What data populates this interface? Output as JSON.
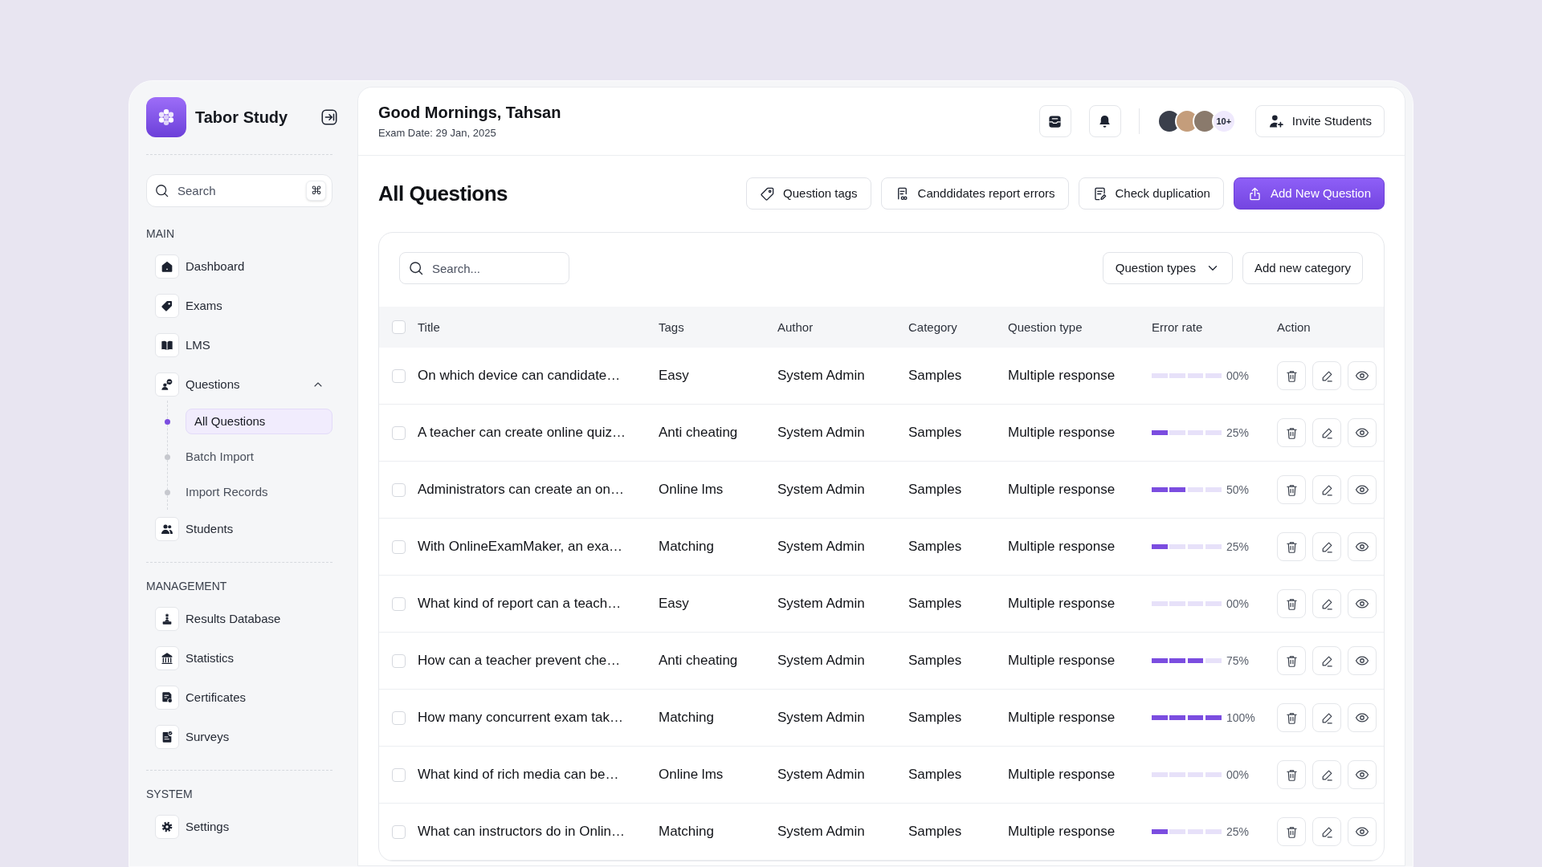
{
  "sidebar": {
    "brand": "Tabor Study",
    "search": {
      "placeholder": "Search",
      "shortcut": "⌘"
    },
    "sections": [
      {
        "heading": "MAIN",
        "items": [
          {
            "label": "Dashboard",
            "selected": false
          },
          {
            "label": "Exams",
            "selected": false
          },
          {
            "label": "LMS",
            "selected": false
          },
          {
            "label": "Questions",
            "selected": false,
            "expanded": true,
            "children": [
              {
                "label": "All Questions",
                "selected": true
              },
              {
                "label": "Batch Import",
                "selected": false
              },
              {
                "label": "Import Records",
                "selected": false
              }
            ]
          },
          {
            "label": "Students",
            "selected": false
          }
        ]
      },
      {
        "heading": "MANAGEMENT",
        "items": [
          {
            "label": "Results Database",
            "selected": false
          },
          {
            "label": "Statistics",
            "selected": false
          },
          {
            "label": "Certificates",
            "selected": false
          },
          {
            "label": "Surveys",
            "selected": false
          }
        ]
      },
      {
        "heading": "SYSTEM",
        "items": [
          {
            "label": "Settings",
            "selected": false
          }
        ]
      }
    ]
  },
  "header": {
    "greeting": "Good Mornings, Tahsan",
    "exam_date": "Exam Date: 29 Jan, 2025",
    "avatars_more": "10+",
    "invite_button": "Invite Students"
  },
  "page": {
    "title": "All Questions",
    "actions": [
      {
        "label": "Question tags",
        "kind": "outline"
      },
      {
        "label": "Canddidates report errors",
        "kind": "outline"
      },
      {
        "label": "Check duplication",
        "kind": "outline"
      },
      {
        "label": "Add New Question",
        "kind": "primary"
      }
    ]
  },
  "table": {
    "search": {
      "placeholder": "Search..."
    },
    "filter": "Question types",
    "add_category": "Add new category",
    "select_all": {
      "checked": false
    },
    "columns": [
      "Title",
      "Tags",
      "Author",
      "Category",
      "Question type",
      "Error rate",
      "Action"
    ],
    "rows": [
      {
        "checked": false,
        "title": "On which device can candidate…",
        "tags": "Easy",
        "author": "System Admin",
        "category": "Samples",
        "question_type": "Multiple response",
        "level": 0,
        "error_rate": "00%"
      },
      {
        "checked": false,
        "title": "A teacher can create online quiz…",
        "tags": "Anti cheating",
        "author": "System Admin",
        "category": "Samples",
        "question_type": "Multiple response",
        "level": 0.25,
        "error_rate": "25%"
      },
      {
        "checked": false,
        "title": "Administrators can create an on…",
        "tags": "Online lms",
        "author": "System Admin",
        "category": "Samples",
        "question_type": "Multiple response",
        "level": 0.5,
        "error_rate": "50%"
      },
      {
        "checked": false,
        "title": "With OnlineExamMaker, an exa…",
        "tags": "Matching",
        "author": "System Admin",
        "category": "Samples",
        "question_type": "Multiple response",
        "level": 0.25,
        "error_rate": "25%"
      },
      {
        "checked": false,
        "title": "What kind of report can a teach…",
        "tags": "Easy",
        "author": "System Admin",
        "category": "Samples",
        "question_type": "Multiple response",
        "level": 0,
        "error_rate": "00%"
      },
      {
        "checked": false,
        "title": "How can a teacher prevent che…",
        "tags": "Anti cheating",
        "author": "System Admin",
        "category": "Samples",
        "question_type": "Multiple response",
        "level": 0.75,
        "error_rate": "75%"
      },
      {
        "checked": false,
        "title": "How many concurrent exam tak…",
        "tags": "Matching",
        "author": "System Admin",
        "category": "Samples",
        "question_type": "Multiple response",
        "level": 1,
        "error_rate": "100%"
      },
      {
        "checked": false,
        "title": "What kind of rich media can be…",
        "tags": "Online lms",
        "author": "System Admin",
        "category": "Samples",
        "question_type": "Multiple response",
        "level": 0,
        "error_rate": "00%"
      },
      {
        "checked": false,
        "title": "What can instructors do in Onlin…",
        "tags": "Matching",
        "author": "System Admin",
        "category": "Samples",
        "question_type": "Multiple response",
        "level": 0.25,
        "error_rate": "25%"
      }
    ]
  }
}
